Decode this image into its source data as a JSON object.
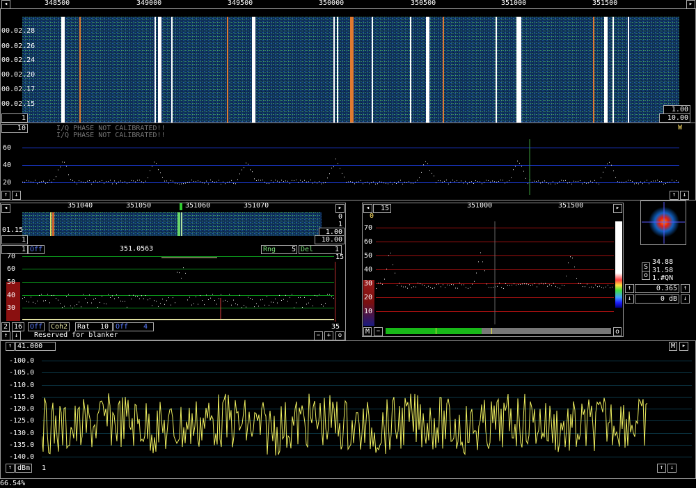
{
  "main_waterfall": {
    "freq_ticks": [
      "348500",
      "349000",
      "349500",
      "350000",
      "350500",
      "351000",
      "351500"
    ],
    "time_labels": [
      "00.02.28",
      "00.02.26",
      "00.02.24",
      "00.02.20",
      "00.02.17",
      "00.02.15"
    ],
    "left_box": "1",
    "right_box_1": "1.00",
    "right_box_2": "10.00"
  },
  "main_spectrum": {
    "avg_box": "10",
    "warning_1": "I/Q PHASE NOT CALIBRATED!!",
    "warning_2": "I/Q PHASE NOT CALIBRATED!!",
    "w_label": "W",
    "y_ticks": [
      "60",
      "40",
      "20"
    ]
  },
  "baseband": {
    "freq_ticks": [
      "351040",
      "351050",
      "351060",
      "351070"
    ],
    "time_label": "01.15",
    "right_vals": [
      "0",
      "1"
    ],
    "box_left": "1",
    "box_right_1": "1.00",
    "box_right_2": "10.00",
    "mode_box": "1",
    "off_label": "Off",
    "freq": "351.0563",
    "rng_label": "Rng",
    "rng_val": "5",
    "del_label": "Del",
    "del_val": "1",
    "y_ticks": [
      "70",
      "60",
      "50",
      "40",
      "30"
    ],
    "right_val": "15",
    "bottom_right": "35",
    "bottom_controls": {
      "c1": "2",
      "c2": "16",
      "c3": "Off",
      "c4": "Coh2",
      "c5": "Rat",
      "c6": "10",
      "c7": "Off",
      "c8": "4"
    },
    "reserved": "Reserved for blanker"
  },
  "high_res": {
    "avg_box": "15",
    "freq_ticks": [
      "351000",
      "351500"
    ],
    "zero_label": "0",
    "y_ticks": [
      "70",
      "60",
      "50",
      "40",
      "30",
      "20",
      "10"
    ],
    "m_button": "M",
    "o_button": "o"
  },
  "polar": {
    "val1": "34.88",
    "val2": "31.58",
    "val3": "1.#QN",
    "s_label": "S",
    "o_label": "o",
    "gain_1": "0.365",
    "gain_2": "0 dB"
  },
  "audio": {
    "level_box": "41.000",
    "m_label": "M",
    "y_ticks": [
      "-100.0",
      "-105.0",
      "-110.0",
      "-115.0",
      "-120.0",
      "-125.0",
      "-130.0",
      "-135.0",
      "-140.0"
    ],
    "unit": "dBm",
    "unit_val": "1"
  },
  "status": {
    "cpu": "66.54%"
  },
  "colors": {
    "grid_blue": "#1c3bd6",
    "grid_red": "#a01010",
    "grid_green": "#0a8f1a",
    "trace_yellow": "#f0f060",
    "frame": "#9a9a9a"
  }
}
